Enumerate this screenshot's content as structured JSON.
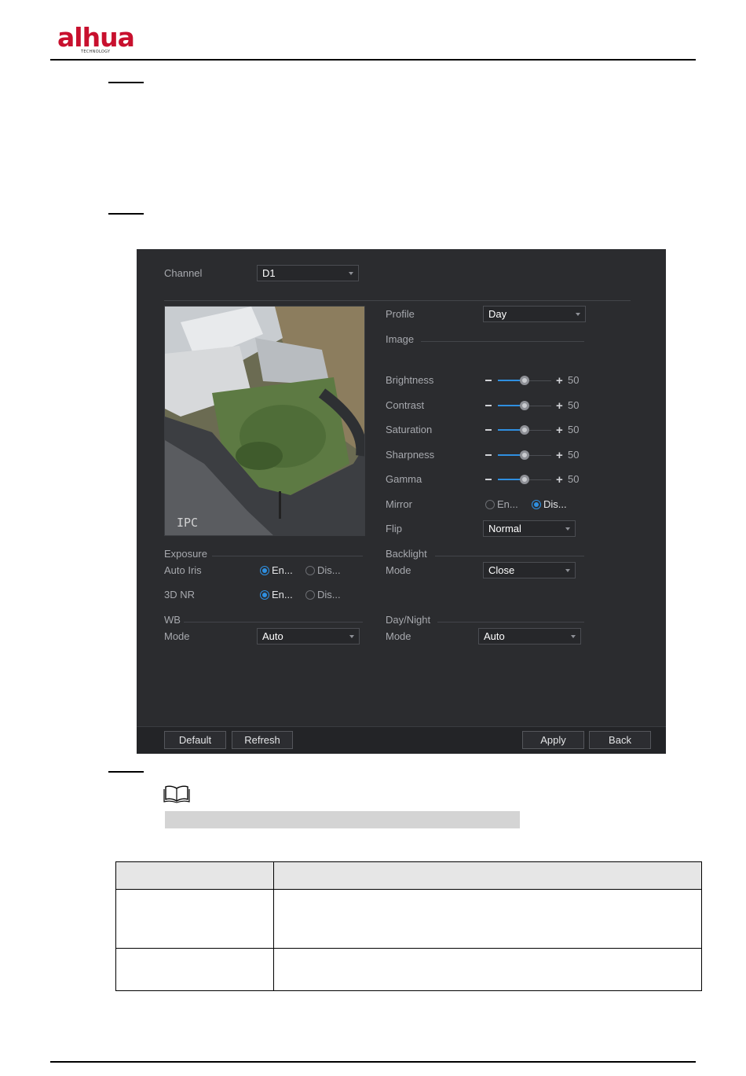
{
  "header": {
    "logo_text": "alhua",
    "logo_sub": "TECHNOLOGY"
  },
  "panel": {
    "channel_label": "Channel",
    "channel_value": "D1",
    "preview_tag": "IPC",
    "profile_label": "Profile",
    "profile_value": "Day",
    "image_section": "Image",
    "sliders": [
      {
        "label": "Brightness",
        "value": "50",
        "level": 0.5
      },
      {
        "label": "Contrast",
        "value": "50",
        "level": 0.5
      },
      {
        "label": "Saturation",
        "value": "50",
        "level": 0.5
      },
      {
        "label": "Sharpness",
        "value": "50",
        "level": 0.5
      },
      {
        "label": "Gamma",
        "value": "50",
        "level": 0.5
      }
    ],
    "mirror": {
      "label": "Mirror",
      "enable": "En...",
      "disable": "Dis...",
      "selected": "disable"
    },
    "flip": {
      "label": "Flip",
      "value": "Normal"
    },
    "exposure_section": "Exposure",
    "auto_iris": {
      "label": "Auto Iris",
      "enable": "En...",
      "disable": "Dis...",
      "selected": "enable"
    },
    "nr3d": {
      "label": "3D NR",
      "enable": "En...",
      "disable": "Dis...",
      "selected": "enable"
    },
    "backlight_section": "Backlight",
    "backlight_mode": {
      "label": "Mode",
      "value": "Close"
    },
    "wb_section": "WB",
    "wb_mode": {
      "label": "Mode",
      "value": "Auto"
    },
    "daynight_section": "Day/Night",
    "daynight_mode": {
      "label": "Mode",
      "value": "Auto"
    },
    "buttons": {
      "default": "Default",
      "refresh": "Refresh",
      "apply": "Apply",
      "back": "Back"
    }
  },
  "colors": {
    "brand_red": "#c8102e",
    "panel_bg": "#2b2c2f",
    "accent_blue": "#2f8fe0"
  },
  "icons": {
    "note": "book-icon",
    "dropdown": "caret-down-icon"
  }
}
